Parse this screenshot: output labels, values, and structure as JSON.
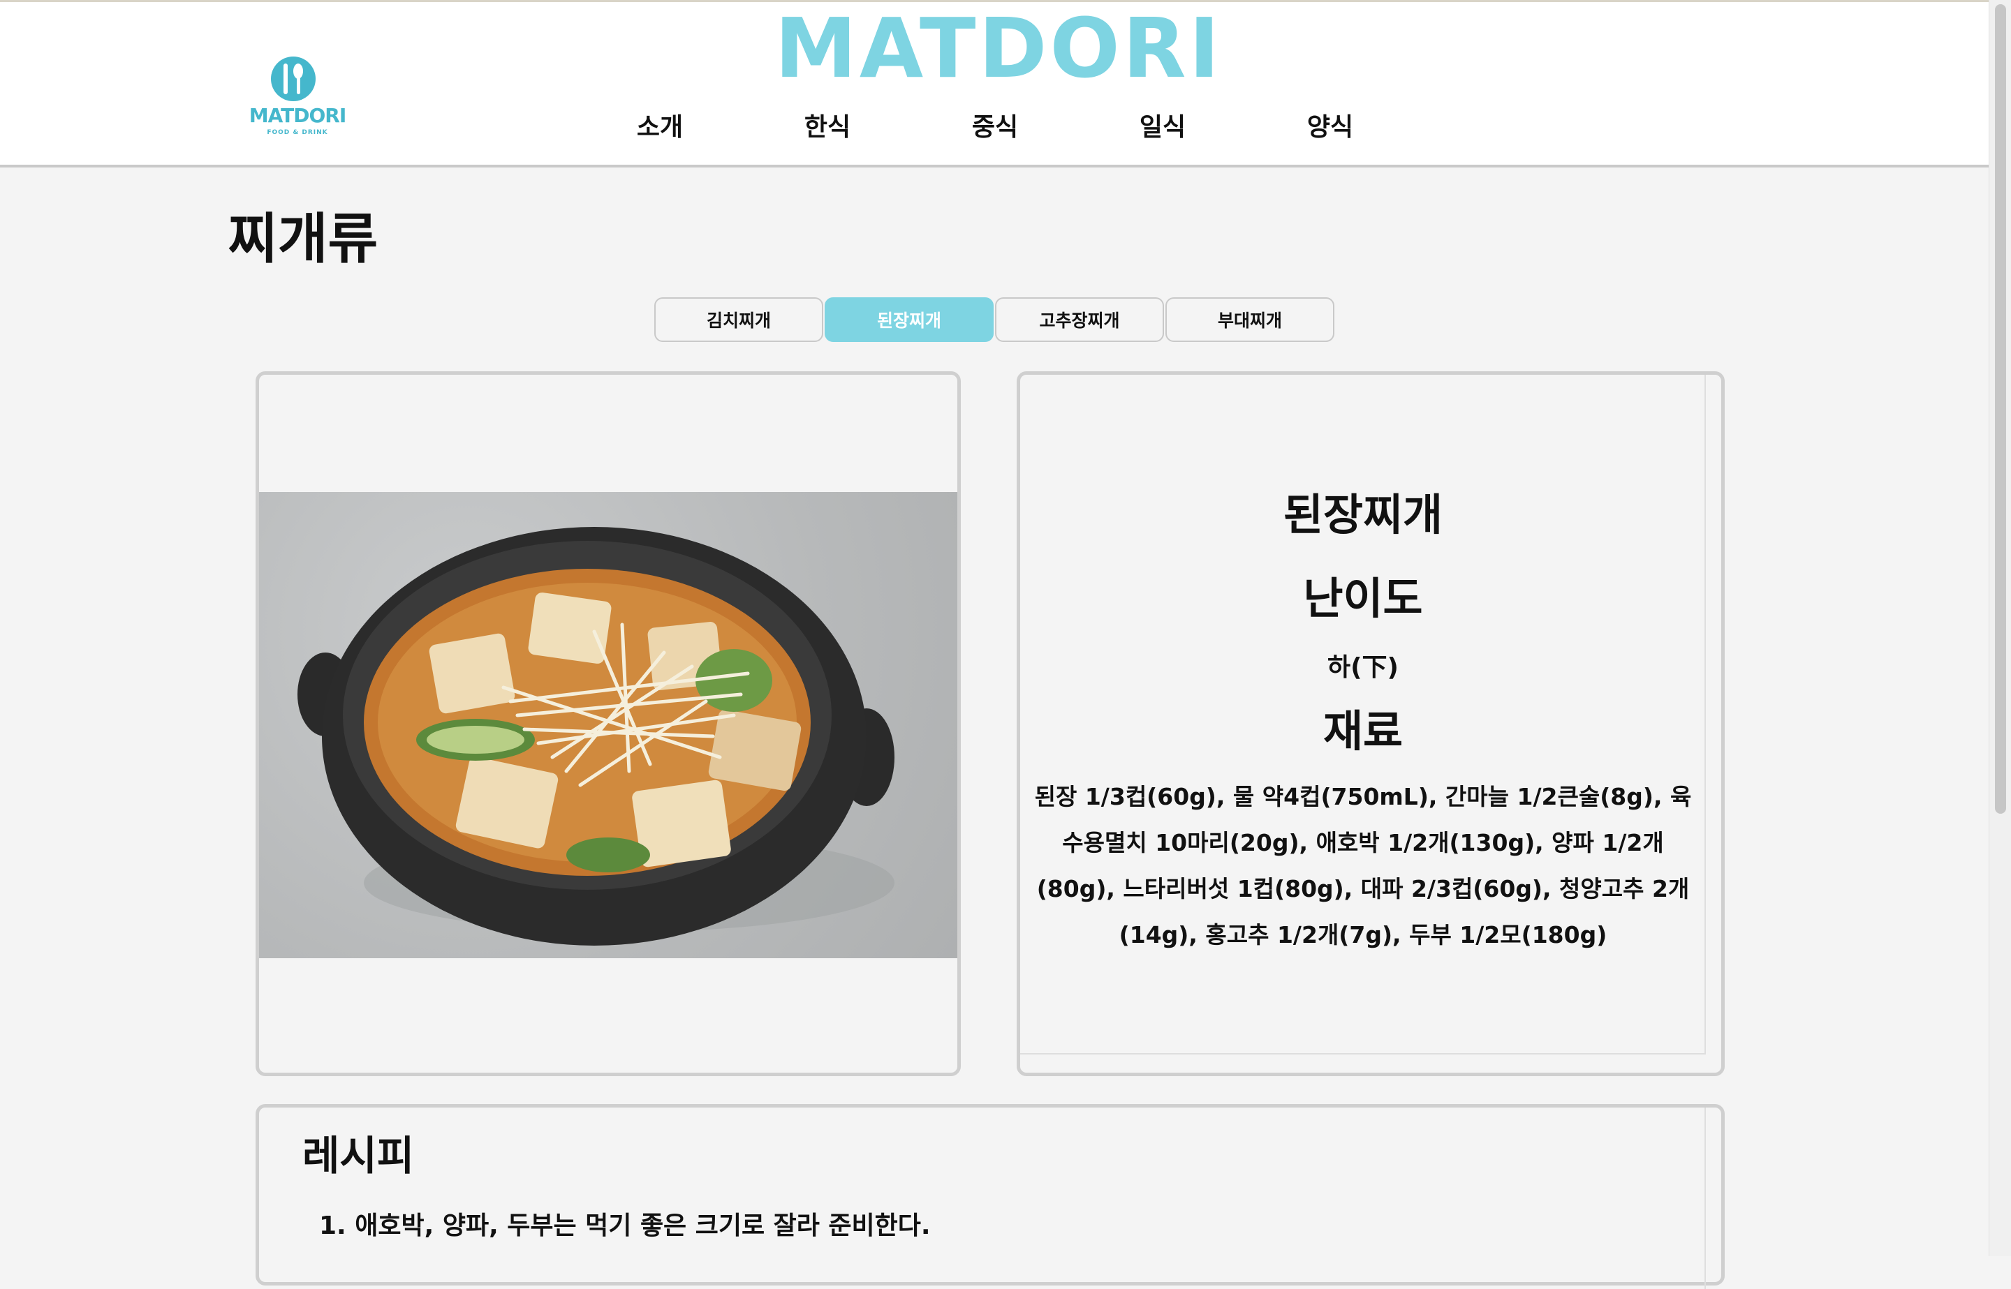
{
  "header": {
    "logo_text": "MATDORI",
    "logo_sub": "FOOD & DRINK",
    "brand": "MATDORI",
    "nav": [
      "소개",
      "한식",
      "중식",
      "일식",
      "양식"
    ]
  },
  "section": {
    "title": "찌개류"
  },
  "tabs": [
    "김치찌개",
    "된장찌개",
    "고추장찌개",
    "부대찌개"
  ],
  "active_tab": "된장찌개",
  "info": {
    "dish_name": "된장찌개",
    "difficulty_label": "난이도",
    "difficulty_value": "하(下)",
    "ingredients_label": "재료",
    "ingredients": "된장 1/3컵(60g), 물 약4컵(750mL), 간마늘 1/2큰술(8g), 육수용멸치 10마리(20g), 애호박 1/2개(130g), 양파 1/2개(80g), 느타리버섯 1컵(80g), 대파 2/3컵(60g), 청양고추 2개(14g), 홍고추 1/2개(7g), 두부 1/2모(180g)"
  },
  "recipe": {
    "title": "레시피",
    "steps": [
      "1. 애호박, 양파, 두부는 먹기 좋은 크기로 잘라 준비한다."
    ]
  },
  "colors": {
    "accent": "#7ed4e2",
    "logo": "#45b7cc",
    "background": "#f4f4f4"
  }
}
